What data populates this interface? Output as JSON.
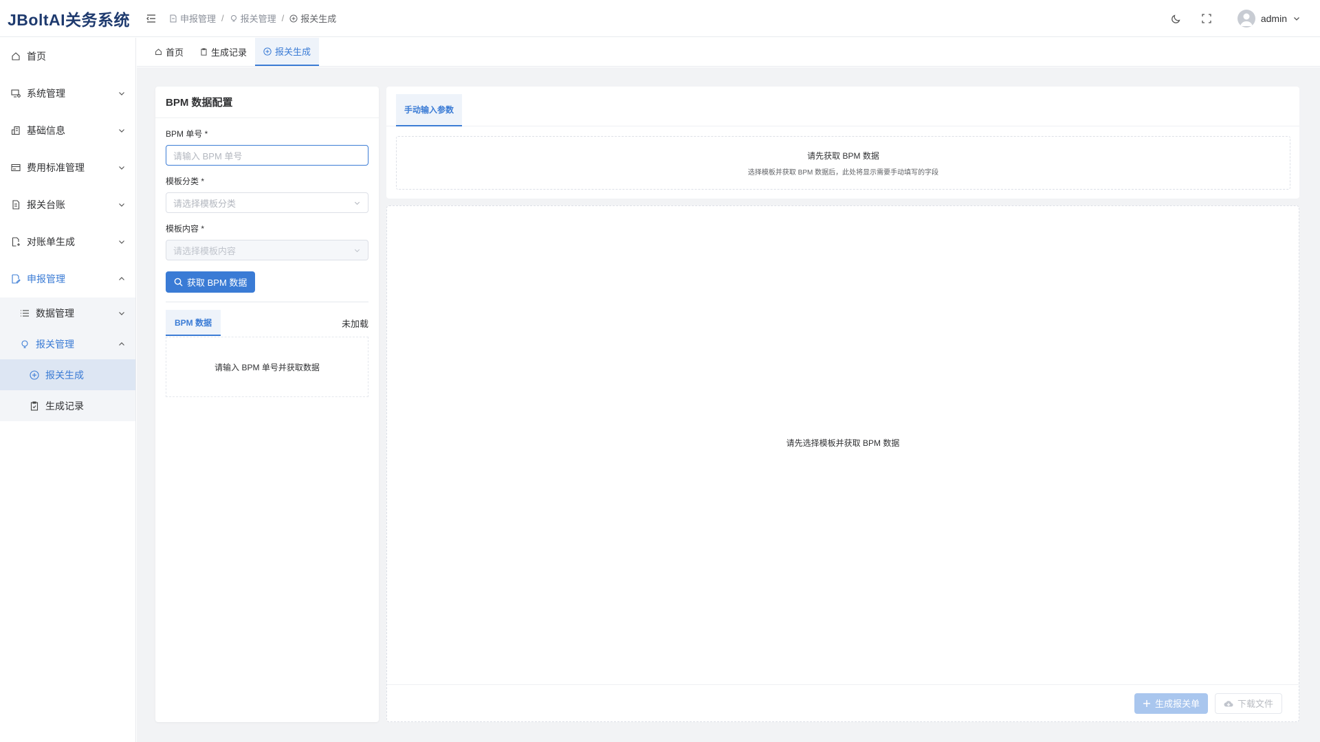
{
  "app": {
    "title": "JBoltAI关务系统"
  },
  "header": {
    "breadcrumb": [
      {
        "label": "申报管理",
        "icon": "edit-doc-icon"
      },
      {
        "label": "报关管理",
        "icon": "bulb-icon"
      },
      {
        "label": "报关生成",
        "icon": "plus-circle-icon"
      }
    ],
    "separator": "/",
    "user": {
      "name": "admin"
    }
  },
  "sidebar": {
    "items": [
      {
        "label": "首页",
        "icon": "home-icon"
      },
      {
        "label": "系统管理",
        "icon": "monitor-settings-icon"
      },
      {
        "label": "基础信息",
        "icon": "building-icon"
      },
      {
        "label": "费用标准管理",
        "icon": "card-icon"
      },
      {
        "label": "报关台账",
        "icon": "document-icon"
      },
      {
        "label": "对账单生成",
        "icon": "file-add-icon"
      },
      {
        "label": "申报管理",
        "icon": "edit-doc-icon"
      }
    ],
    "sub": {
      "data_mgmt": "数据管理",
      "customs_mgmt": "报关管理",
      "leaf_generate": "报关生成",
      "leaf_records": "生成记录"
    }
  },
  "tabs": [
    {
      "label": "首页"
    },
    {
      "label": "生成记录"
    },
    {
      "label": "报关生成"
    }
  ],
  "left_panel": {
    "title": "BPM 数据配置",
    "bpm_label": "BPM 单号 *",
    "bpm_placeholder": "请输入 BPM 单号",
    "category_label": "模板分类 *",
    "category_placeholder": "请选择模板分类",
    "content_label": "模板内容 *",
    "content_placeholder": "请选择模板内容",
    "fetch_button": "获取 BPM 数据",
    "data_tab": "BPM 数据",
    "status": "未加载",
    "empty_hint": "请输入 BPM 单号并获取数据"
  },
  "right_top": {
    "tab": "手动输入参数",
    "title": "请先获取 BPM 数据",
    "subtitle": "选择模板并获取 BPM 数据后，此处将显示需要手动填写的字段"
  },
  "right_bottom": {
    "empty_hint": "请先选择模板并获取 BPM 数据",
    "generate_button": "生成报关单",
    "download_button": "下载文件"
  },
  "colors": {
    "primary": "#3a7bd5",
    "brand": "#1e3a6e",
    "background": "#f2f3f5"
  }
}
